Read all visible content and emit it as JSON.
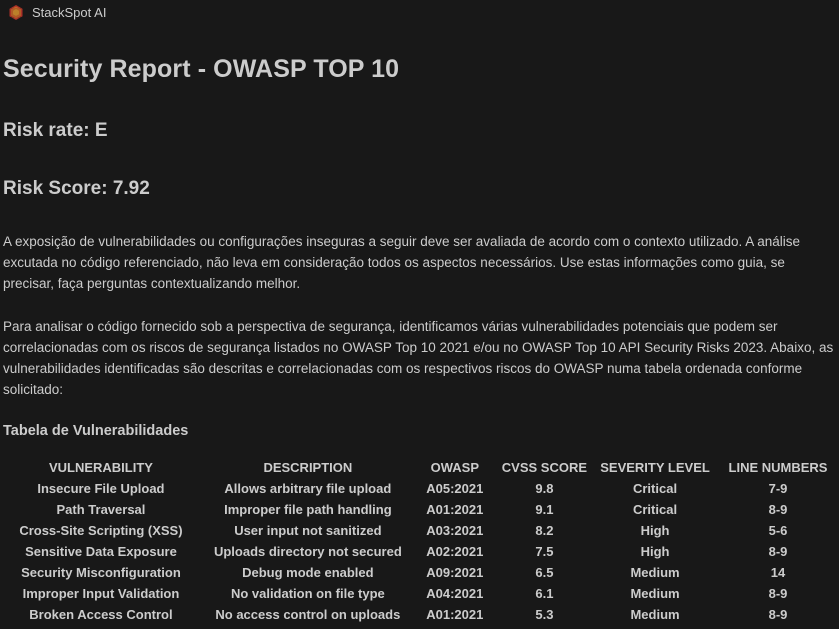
{
  "header": {
    "logo_icon": "stackspot-hexagon-logo",
    "app_title": "StackSpot AI"
  },
  "report": {
    "title": "Security Report - OWASP TOP 10",
    "risk_rate": "Risk rate: E",
    "risk_score": "Risk Score: 7.92",
    "paragraph_1": "A exposição de vulnerabilidades ou configurações inseguras a seguir deve ser avaliada de acordo com o contexto utilizado. A análise excutada no código referenciado, não leva em consideração todos os aspectos necessários. Use estas informações como guia, se precisar, faça perguntas contextualizando melhor.",
    "paragraph_2": "Para analisar o código fornecido sob a perspectiva de segurança, identificamos várias vulnerabilidades potenciais que podem ser correlacionadas com os riscos de segurança listados no OWASP Top 10 2021 e/ou no OWASP Top 10 API Security Risks 2023. Abaixo, as vulnerabilidades identificadas são descritas e correlacionadas com os respectivos riscos do OWASP numa tabela ordenada conforme solicitado:",
    "table_title": "Tabela de Vulnerabilidades"
  },
  "table": {
    "headers": [
      "VULNERABILITY",
      "DESCRIPTION",
      "OWASP",
      "CVSS SCORE",
      "SEVERITY LEVEL",
      "LINE NUMBERS"
    ],
    "rows": [
      [
        "Insecure File Upload",
        "Allows arbitrary file upload",
        "A05:2021",
        "9.8",
        "Critical",
        "7-9"
      ],
      [
        "Path Traversal",
        "Improper file path handling",
        "A01:2021",
        "9.1",
        "Critical",
        "8-9"
      ],
      [
        "Cross-Site Scripting (XSS)",
        "User input not sanitized",
        "A03:2021",
        "8.2",
        "High",
        "5-6"
      ],
      [
        "Sensitive Data Exposure",
        "Uploads directory not secured",
        "A02:2021",
        "7.5",
        "High",
        "8-9"
      ],
      [
        "Security Misconfiguration",
        "Debug mode enabled",
        "A09:2021",
        "6.5",
        "Medium",
        "14"
      ],
      [
        "Improper Input Validation",
        "No validation on file type",
        "A04:2021",
        "6.1",
        "Medium",
        "8-9"
      ],
      [
        "Broken Access Control",
        "No access control on uploads",
        "A01:2021",
        "5.3",
        "Medium",
        "8-9"
      ]
    ]
  },
  "colors": {
    "background": "#181818",
    "text": "#cccccc",
    "logo_orange": "#e0702a",
    "logo_red": "#c2352a",
    "logo_yellow": "#f0a030"
  }
}
